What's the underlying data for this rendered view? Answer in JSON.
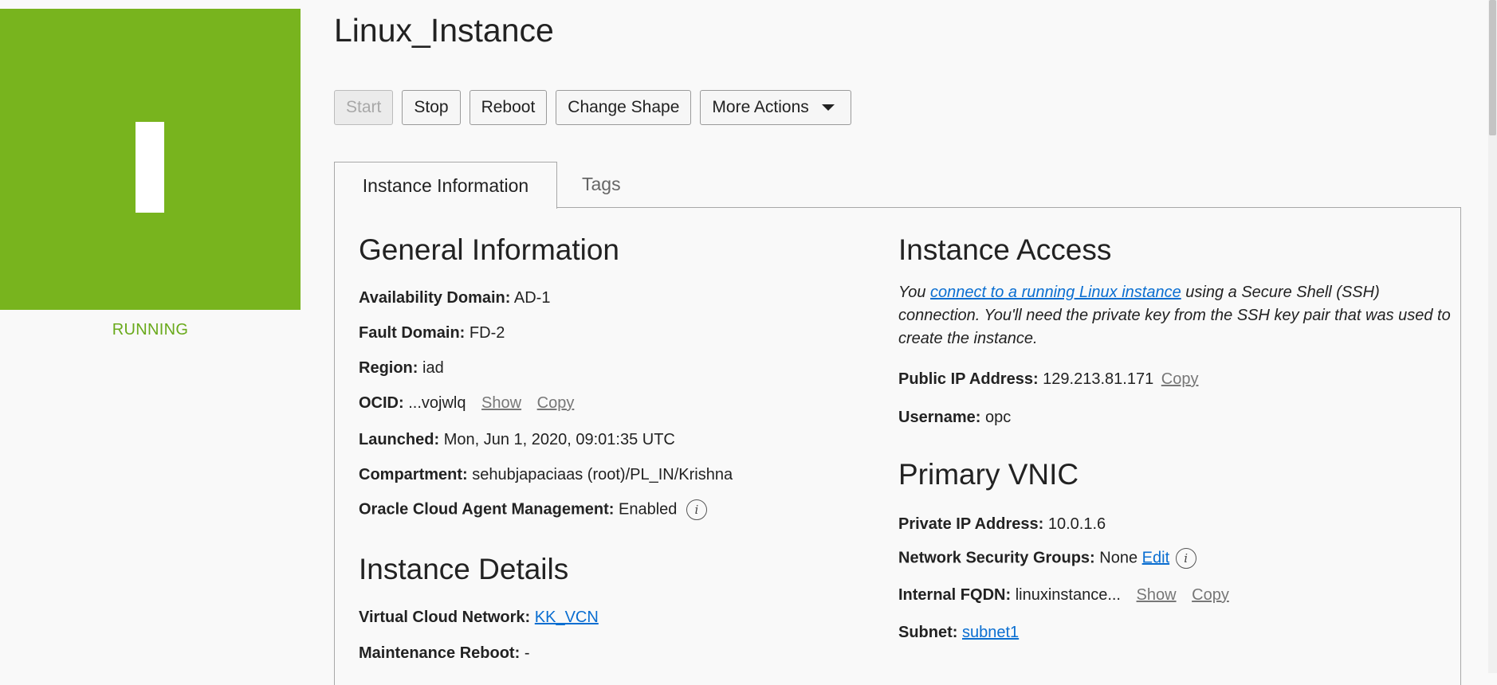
{
  "status": {
    "state": "RUNNING",
    "tile_color": "#78b41e"
  },
  "title": "Linux_Instance",
  "toolbar": {
    "start": "Start",
    "stop": "Stop",
    "reboot": "Reboot",
    "change_shape": "Change Shape",
    "more_actions": "More Actions"
  },
  "tabs": {
    "instance_information": "Instance Information",
    "tags": "Tags"
  },
  "general": {
    "title": "General Information",
    "availability_domain": {
      "label": "Availability Domain:",
      "value": "AD-1"
    },
    "fault_domain": {
      "label": "Fault Domain:",
      "value": "FD-2"
    },
    "region": {
      "label": "Region:",
      "value": "iad"
    },
    "ocid": {
      "label": "OCID:",
      "value": "...vojwlq",
      "show": "Show",
      "copy": "Copy"
    },
    "launched": {
      "label": "Launched:",
      "value": "Mon, Jun 1, 2020, 09:01:35 UTC"
    },
    "compartment": {
      "label": "Compartment:",
      "value": "sehubjapaciaas (root)/PL_IN/Krishna"
    },
    "agent": {
      "label": "Oracle Cloud Agent Management:",
      "value": "Enabled"
    }
  },
  "details": {
    "title": "Instance Details",
    "vcn": {
      "label": "Virtual Cloud Network:",
      "value": "KK_VCN"
    },
    "maintenance": {
      "label": "Maintenance Reboot:",
      "value": "-"
    }
  },
  "access": {
    "title": "Instance Access",
    "text_before": "You ",
    "link": "connect to a running Linux instance",
    "text_after": " using a Secure Shell (SSH) connection. You'll need the private key from the SSH key pair that was used to create the instance.",
    "public_ip": {
      "label": "Public IP Address:",
      "value": "129.213.81.171",
      "copy": "Copy"
    },
    "username": {
      "label": "Username:",
      "value": "opc"
    }
  },
  "vnic": {
    "title": "Primary VNIC",
    "private_ip": {
      "label": "Private IP Address:",
      "value": "10.0.1.6"
    },
    "nsg": {
      "label": "Network Security Groups:",
      "value": "None",
      "edit": "Edit"
    },
    "fqdn": {
      "label": "Internal FQDN:",
      "value": "linuxinstance...",
      "show": "Show",
      "copy": "Copy"
    },
    "subnet": {
      "label": "Subnet:",
      "value": "subnet1"
    }
  },
  "icons": {
    "info": "info-icon",
    "caret": "caret-down-icon"
  },
  "colors": {
    "link": "#0a6ed1",
    "running": "#6aaa1c"
  }
}
